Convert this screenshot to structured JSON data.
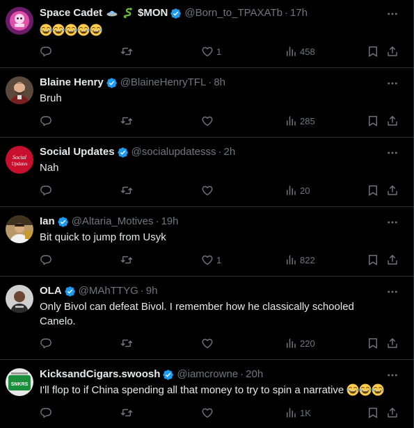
{
  "colors": {
    "background": "#000000",
    "text": "#e7e9ea",
    "muted": "#71767b",
    "verified": "#1d9bf0",
    "divider": "#2f3336"
  },
  "icons": [
    "more-icon",
    "reply-icon",
    "retweet-icon",
    "like-icon",
    "views-icon",
    "bookmark-icon",
    "share-icon",
    "verified-badge-icon"
  ],
  "tweets": [
    {
      "name": "Space Cadet",
      "name_suffix": "$MON",
      "handle": "@Born_to_TPAXATb",
      "time": "17h",
      "text": "",
      "emoji_count": 5,
      "likes": "1",
      "views": "458"
    },
    {
      "name": "Blaine Henry",
      "handle": "@BlaineHenryTFL",
      "time": "8h",
      "text": "Bruh",
      "likes": "",
      "views": "285"
    },
    {
      "name": "Social Updates",
      "handle": "@socialupdatesss",
      "time": "2h",
      "text": "Nah",
      "avatar_text": "Social Updates",
      "likes": "",
      "views": "20"
    },
    {
      "name": "Ian",
      "handle": "@Altaria_Motives",
      "time": "19h",
      "text": "Bit quick to jump from Usyk",
      "likes": "1",
      "views": "822"
    },
    {
      "name": "OLA",
      "handle": "@MAhTTYG",
      "time": "9h",
      "text_line1": "Only Bivol can defeat Bivol. I remember how he classically schooled",
      "text_line2": "Canelo.",
      "likes": "",
      "views": "220"
    },
    {
      "name": "KicksandCigars.swoosh",
      "handle": "@iamcrowne",
      "time": "20h",
      "text": "I'll flop to if China spending all that money to try to spin a narrative",
      "avatar_text": "SNKRS",
      "likes": "",
      "views": "1K"
    }
  ]
}
